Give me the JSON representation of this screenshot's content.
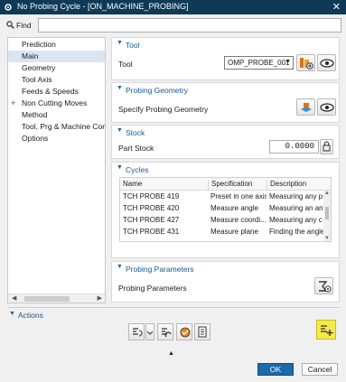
{
  "window": {
    "title": "No Probing Cycle - [ON_MACHINE_PROBING]",
    "close": "✕"
  },
  "find": {
    "label": "Find",
    "value": ""
  },
  "nav": {
    "items": [
      {
        "label": "Prediction",
        "expandable": false,
        "selected": false
      },
      {
        "label": "Main",
        "expandable": false,
        "selected": true
      },
      {
        "label": "Geometry",
        "expandable": false,
        "selected": false
      },
      {
        "label": "Tool Axis",
        "expandable": false,
        "selected": false
      },
      {
        "label": "Feeds & Speeds",
        "expandable": false,
        "selected": false
      },
      {
        "label": "Non Cutting Moves",
        "expandable": true,
        "selected": false
      },
      {
        "label": "Method",
        "expandable": false,
        "selected": false
      },
      {
        "label": "Tool, Prg & Machine Contr",
        "expandable": false,
        "selected": false
      },
      {
        "label": "Options",
        "expandable": false,
        "selected": false
      }
    ]
  },
  "tool_group": {
    "title": "Tool",
    "label": "Tool",
    "selected": "OMP_PROBE_001"
  },
  "geometry_group": {
    "title": "Probing Geometry",
    "label": "Specify Probing Geometry"
  },
  "stock_group": {
    "title": "Stock",
    "label": "Part Stock",
    "value": "0.0000"
  },
  "cycles_group": {
    "title": "Cycles",
    "columns": [
      "Name",
      "Specification",
      "Description"
    ],
    "rows": [
      {
        "name": "TCH PROBE 419",
        "spec": "Preset in one axis",
        "desc": "Measuring any p"
      },
      {
        "name": "TCH PROBE 420",
        "spec": "Measure angle",
        "desc": "Measuring an an"
      },
      {
        "name": "TCH PROBE 427",
        "spec": "Measure coordi...",
        "desc": "Measuring any c"
      },
      {
        "name": "TCH PROBE 431",
        "spec": "Measure plane",
        "desc": "Finding the angle"
      }
    ]
  },
  "probing_params_group": {
    "title": "Probing Parameters",
    "label": "Probing Parameters"
  },
  "actions": {
    "title": "Actions"
  },
  "buttons": {
    "ok": "OK",
    "cancel": "Cancel"
  },
  "colors": {
    "titlebar": "#0e3a57",
    "accent": "#17588f",
    "ok_button": "#1d6aa8",
    "highlight": "#f6e94a"
  }
}
